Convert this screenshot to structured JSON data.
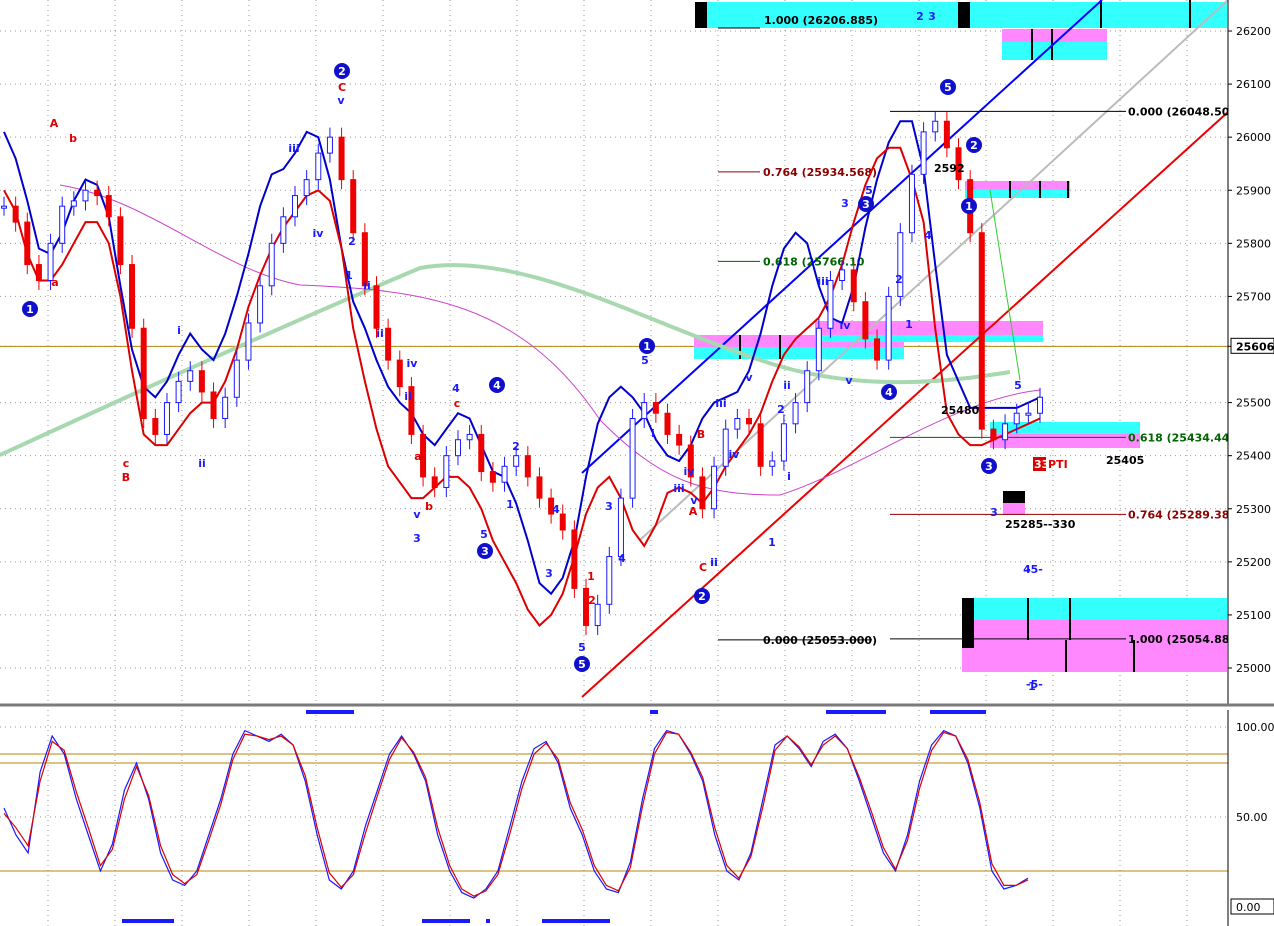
{
  "chart_data": [
    {
      "type": "candlestick",
      "price_axis": {
        "ticks": [
          "26200",
          "26100",
          "26000",
          "25900",
          "25800",
          "25700",
          "25606.",
          "25500",
          "25400",
          "25300",
          "25200",
          "25100",
          "25000"
        ],
        "ylim": [
          24940,
          26250
        ],
        "current_price": "25606."
      },
      "fib_levels": [
        {
          "label": "1.000 (26206.885)",
          "price": 26206.885,
          "color": "#000000"
        },
        {
          "label": "0.000 (26048.509",
          "price": 26048.509,
          "color": "#000000"
        },
        {
          "label": "0.764 (25934.568)",
          "price": 25934.568,
          "color": "#8b0000"
        },
        {
          "label": "0.618 (25766.10",
          "price": 25766.1,
          "color": "#006400"
        },
        {
          "label": "0.618 (25434.449",
          "price": 25434.449,
          "color": "#006400"
        },
        {
          "label": "0.764 (25289.380",
          "price": 25289.38,
          "color": "#8b0000"
        },
        {
          "label": "0.000 (25053.000)",
          "price": 25053.0,
          "color": "#000000"
        },
        {
          "label": "1.000 (25054.885",
          "price": 25054.885,
          "color": "#000000"
        }
      ],
      "annotations": [
        "25480",
        "25405",
        "25285--330",
        "2592",
        "PTI",
        "33",
        "-5-",
        "-5-"
      ],
      "series": [
        {
          "name": "price",
          "color": "#1a1aff",
          "values": [
            25870,
            25840,
            25760,
            25730,
            25800,
            25870,
            25880,
            25900,
            25890,
            25850,
            25760,
            25640,
            25470,
            25440,
            25500,
            25540,
            25560,
            25520,
            25470,
            25510,
            25580,
            25650,
            25720,
            25800,
            25850,
            25890,
            25920,
            25970,
            26000,
            25920,
            25820,
            25720,
            25640,
            25580,
            25530,
            25440,
            25360,
            25340,
            25400,
            25430,
            25440,
            25370,
            25350,
            25380,
            25400,
            25360,
            25320,
            25290,
            25260,
            25150,
            25080,
            25120,
            25210,
            25320,
            25470,
            25500,
            25480,
            25440,
            25420,
            25360,
            25300,
            25380,
            25450,
            25470,
            25460,
            25380,
            25390,
            25460,
            25500,
            25560,
            25640,
            25730,
            25750,
            25690,
            25620,
            25580,
            25700,
            25820,
            25930,
            26010,
            26030,
            25980,
            25920,
            25820,
            25450,
            25430,
            25460,
            25480,
            25480,
            25510
          ]
        },
        {
          "name": "upper envelope",
          "color": "#0000cc",
          "values": [
            26010,
            25960,
            25880,
            25790,
            25780,
            25820,
            25880,
            25920,
            25910,
            25850,
            25720,
            25600,
            25530,
            25510,
            25540,
            25590,
            25630,
            25600,
            25580,
            25630,
            25700,
            25780,
            25870,
            25930,
            25940,
            25970,
            26010,
            26000,
            25920,
            25790,
            25690,
            25640,
            25580,
            25530,
            25500,
            25480,
            25440,
            25420,
            25450,
            25480,
            25470,
            25420,
            25370,
            25360,
            25310,
            25240,
            25160,
            25140,
            25170,
            25240,
            25360,
            25460,
            25510,
            25530,
            25510,
            25480,
            25430,
            25400,
            25390,
            25420,
            25470,
            25500,
            25510,
            25520,
            25560,
            25630,
            25720,
            25790,
            25820,
            25800,
            25720,
            25660,
            25650,
            25720,
            25830,
            25920,
            25990,
            26030,
            26030,
            25940,
            25760,
            25590,
            25540,
            25490,
            25490,
            25490,
            25490,
            25490,
            25500,
            25510
          ]
        },
        {
          "name": "lower envelope",
          "color": "#dd0000",
          "values": [
            25900,
            25860,
            25780,
            25730,
            25730,
            25760,
            25800,
            25840,
            25840,
            25800,
            25700,
            25560,
            25440,
            25420,
            25420,
            25450,
            25480,
            25500,
            25500,
            25540,
            25600,
            25680,
            25740,
            25790,
            25830,
            25860,
            25890,
            25900,
            25880,
            25790,
            25640,
            25540,
            25450,
            25380,
            25350,
            25320,
            25320,
            25340,
            25360,
            25360,
            25340,
            25300,
            25240,
            25200,
            25160,
            25110,
            25080,
            25100,
            25140,
            25210,
            25290,
            25340,
            25360,
            25320,
            25260,
            25230,
            25270,
            25330,
            25340,
            25330,
            25310,
            25340,
            25380,
            25410,
            25440,
            25480,
            25540,
            25590,
            25620,
            25640,
            25660,
            25700,
            25760,
            25840,
            25910,
            25960,
            25980,
            25980,
            25920,
            25840,
            25640,
            25480,
            25440,
            25420,
            25420,
            25430,
            25440,
            25450,
            25460,
            25470
          ]
        }
      ],
      "wave_labels": [
        {
          "text": "1",
          "circled": true,
          "color": "#1a1aff"
        },
        {
          "text": "2",
          "circled": true,
          "color": "#1a1aff"
        },
        {
          "text": "3",
          "circled": true,
          "color": "#1a1aff"
        },
        {
          "text": "4",
          "circled": true,
          "color": "#1a1aff"
        },
        {
          "text": "5",
          "circled": true,
          "color": "#1a1aff"
        },
        {
          "text": "1",
          "circled": true,
          "color": "#1a1aff"
        },
        {
          "text": "2",
          "circled": true,
          "color": "#1a1aff"
        },
        {
          "text": "3",
          "circled": true,
          "color": "#1a1aff"
        },
        {
          "text": "4",
          "circled": true,
          "color": "#1a1aff"
        },
        {
          "text": "5",
          "circled": true,
          "color": "#1a1aff"
        },
        {
          "text": "1",
          "circled": true,
          "color": "#1a1aff"
        },
        {
          "text": "2",
          "circled": true,
          "color": "#1a1aff"
        },
        {
          "text": "3",
          "circled": true,
          "color": "#1a1aff"
        },
        {
          "text": "A",
          "circled": false,
          "color": "#dd0000"
        },
        {
          "text": "b",
          "circled": false,
          "color": "#dd0000"
        },
        {
          "text": "a",
          "circled": false,
          "color": "#dd0000"
        },
        {
          "text": "c",
          "circled": false,
          "color": "#dd0000"
        },
        {
          "text": "B",
          "circled": false,
          "color": "#dd0000"
        },
        {
          "text": "C",
          "circled": false,
          "color": "#dd0000"
        },
        {
          "text": "v",
          "circled": false,
          "color": "#1a1aff"
        },
        {
          "text": "iii",
          "circled": false,
          "color": "#1a1aff"
        },
        {
          "text": "iv",
          "circled": false,
          "color": "#1a1aff"
        },
        {
          "text": "ii",
          "circled": false,
          "color": "#1a1aff"
        },
        {
          "text": "i",
          "circled": false,
          "color": "#1a1aff"
        },
        {
          "text": "ii",
          "circled": false,
          "color": "#1a1aff"
        },
        {
          "text": "1",
          "circled": false,
          "color": "#1a1aff"
        },
        {
          "text": "2",
          "circled": false,
          "color": "#1a1aff"
        },
        {
          "text": "ii",
          "circled": false,
          "color": "#1a1aff"
        },
        {
          "text": "ii",
          "circled": false,
          "color": "#1a1aff"
        },
        {
          "text": "iv",
          "circled": false,
          "color": "#1a1aff"
        },
        {
          "text": "4",
          "circled": false,
          "color": "#1a1aff"
        },
        {
          "text": "c",
          "circled": false,
          "color": "#dd0000"
        },
        {
          "text": "a",
          "circled": false,
          "color": "#dd0000"
        },
        {
          "text": "b",
          "circled": false,
          "color": "#dd0000"
        },
        {
          "text": "v",
          "circled": false,
          "color": "#1a1aff"
        },
        {
          "text": "3",
          "circled": false,
          "color": "#1a1aff"
        },
        {
          "text": "5",
          "circled": false,
          "color": "#1a1aff"
        },
        {
          "text": "1",
          "circled": false,
          "color": "#1a1aff"
        },
        {
          "text": "2",
          "circled": false,
          "color": "#1a1aff"
        },
        {
          "text": "3",
          "circled": false,
          "color": "#1a1aff"
        },
        {
          "text": "4",
          "circled": false,
          "color": "#1a1aff"
        },
        {
          "text": "5",
          "circled": false,
          "color": "#1a1aff"
        },
        {
          "text": "1",
          "circled": false,
          "color": "#dd0000"
        },
        {
          "text": "2",
          "circled": false,
          "color": "#dd0000"
        },
        {
          "text": "3",
          "circled": false,
          "color": "#1a1aff"
        },
        {
          "text": "4",
          "circled": false,
          "color": "#1a1aff"
        },
        {
          "text": "5",
          "circled": false,
          "color": "#1a1aff"
        },
        {
          "text": "i",
          "circled": false,
          "color": "#1a1aff"
        },
        {
          "text": "ii",
          "circled": false,
          "color": "#1a1aff"
        },
        {
          "text": "iii",
          "circled": false,
          "color": "#1a1aff"
        },
        {
          "text": "iv",
          "circled": false,
          "color": "#1a1aff"
        },
        {
          "text": "v",
          "circled": false,
          "color": "#1a1aff"
        },
        {
          "text": "A",
          "circled": false,
          "color": "#dd0000"
        },
        {
          "text": "B",
          "circled": false,
          "color": "#dd0000"
        },
        {
          "text": "C",
          "circled": false,
          "color": "#dd0000"
        },
        {
          "text": "ii",
          "circled": false,
          "color": "#1a1aff"
        },
        {
          "text": "iii",
          "circled": false,
          "color": "#1a1aff"
        },
        {
          "text": "iv",
          "circled": false,
          "color": "#1a1aff"
        },
        {
          "text": "v",
          "circled": false,
          "color": "#1a1aff"
        },
        {
          "text": "1",
          "circled": false,
          "color": "#1a1aff"
        },
        {
          "text": "2",
          "circled": false,
          "color": "#1a1aff"
        },
        {
          "text": "i",
          "circled": false,
          "color": "#1a1aff"
        },
        {
          "text": "ii",
          "circled": false,
          "color": "#1a1aff"
        },
        {
          "text": "iii",
          "circled": false,
          "color": "#1a1aff"
        },
        {
          "text": "iv",
          "circled": false,
          "color": "#1a1aff"
        },
        {
          "text": "v",
          "circled": false,
          "color": "#1a1aff"
        },
        {
          "text": "3",
          "circled": false,
          "color": "#1a1aff"
        },
        {
          "text": "4",
          "circled": false,
          "color": "#1a1aff"
        },
        {
          "text": "5",
          "circled": false,
          "color": "#1a1aff"
        },
        {
          "text": "1",
          "circled": false,
          "color": "#1a1aff"
        },
        {
          "text": "2",
          "circled": false,
          "color": "#1a1aff"
        },
        {
          "text": "3",
          "circled": false,
          "color": "#1a1aff"
        },
        {
          "text": "4",
          "circled": false,
          "color": "#1a1aff"
        },
        {
          "text": "5",
          "circled": false,
          "color": "#1a1aff"
        },
        {
          "text": "1",
          "circled": false,
          "color": "#1a1aff"
        },
        {
          "text": "2",
          "circled": false,
          "color": "#1a1aff"
        },
        {
          "text": "3",
          "circled": false,
          "color": "#1a1aff"
        }
      ]
    },
    {
      "type": "line",
      "oscillator_axis": {
        "ticks": [
          "100.00",
          "50.00",
          "0.00"
        ],
        "ylim": [
          0,
          100
        ]
      },
      "series": [
        {
          "name": "oscillator main",
          "color": "#1a1aff",
          "values": [
            55,
            40,
            30,
            75,
            95,
            85,
            60,
            40,
            20,
            35,
            65,
            80,
            60,
            30,
            15,
            12,
            20,
            40,
            60,
            85,
            98,
            95,
            92,
            96,
            90,
            70,
            40,
            15,
            10,
            20,
            45,
            65,
            85,
            95,
            85,
            70,
            40,
            20,
            8,
            5,
            10,
            20,
            45,
            70,
            88,
            92,
            80,
            55,
            40,
            20,
            10,
            8,
            25,
            60,
            88,
            98,
            96,
            85,
            70,
            40,
            20,
            15,
            30,
            60,
            90,
            95,
            88,
            78,
            92,
            96,
            88,
            70,
            50,
            30,
            20,
            40,
            70,
            90,
            98,
            95,
            80,
            55,
            20,
            10,
            12,
            16
          ]
        },
        {
          "name": "oscillator signal",
          "color": "#dd0000",
          "values": [
            52,
            44,
            34,
            70,
            92,
            87,
            64,
            44,
            23,
            32,
            60,
            78,
            62,
            34,
            18,
            13,
            18,
            37,
            57,
            82,
            96,
            95,
            93,
            95,
            90,
            73,
            44,
            19,
            11,
            18,
            41,
            62,
            82,
            94,
            86,
            72,
            44,
            23,
            10,
            6,
            9,
            18,
            41,
            66,
            85,
            91,
            82,
            58,
            43,
            23,
            12,
            9,
            22,
            56,
            85,
            97,
            96,
            86,
            72,
            44,
            23,
            16,
            28,
            56,
            87,
            95,
            89,
            79,
            90,
            95,
            88,
            72,
            53,
            33,
            21,
            37,
            66,
            87,
            97,
            95,
            82,
            58,
            24,
            12,
            12,
            15
          ]
        }
      ]
    }
  ]
}
